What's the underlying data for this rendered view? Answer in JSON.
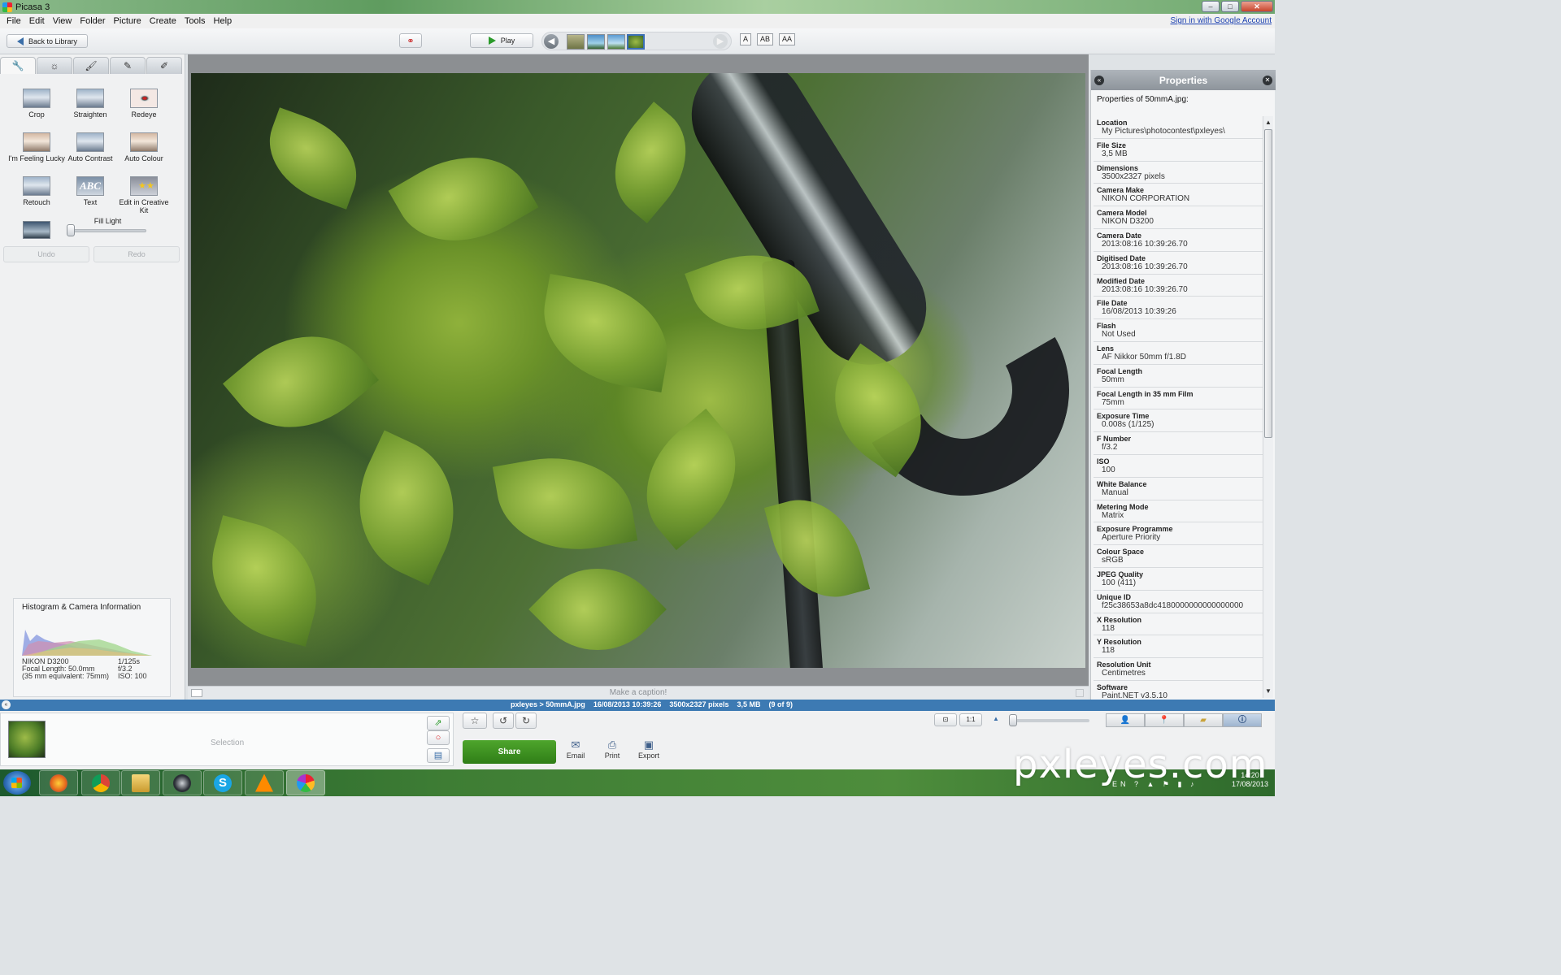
{
  "window": {
    "title": "Picasa 3",
    "controls": [
      "–",
      "□",
      "✕"
    ]
  },
  "menu": {
    "items": [
      "File",
      "Edit",
      "View",
      "Folder",
      "Picture",
      "Create",
      "Tools",
      "Help"
    ],
    "signin": "Sign in with Google Account"
  },
  "toolbar": {
    "back_label": "Back to Library",
    "play_label": "Play",
    "caption_modes": [
      "A",
      "AB",
      "AA"
    ]
  },
  "edit_panel": {
    "tabs": [
      "wrench-icon",
      "sun-icon",
      "brush-icon",
      "effects-icon",
      "effects2-icon"
    ],
    "tools": [
      "Crop",
      "Straighten",
      "Redeye",
      "I'm Feeling Lucky",
      "Auto Contrast",
      "Auto Colour",
      "Retouch",
      "Text",
      "Edit in Creative Kit"
    ],
    "fill_light_label": "Fill Light",
    "fill_light_value": 0,
    "undo_label": "Undo",
    "redo_label": "Redo"
  },
  "histogram": {
    "title": "Histogram & Camera Information",
    "camera": "NIKON D3200",
    "focal": "Focal Length: 50.0mm",
    "equiv": "(35 mm equivalent:  75mm)",
    "shutter": "1/125s",
    "aperture": "f/3.2",
    "iso": "ISO: 100"
  },
  "caption": {
    "placeholder": "Make a caption!"
  },
  "properties": {
    "title": "Properties",
    "subtitle": "Properties of 50mmA.jpg:",
    "items": [
      {
        "label": "Location",
        "value": "My Pictures\\photocontest\\pxleyes\\"
      },
      {
        "label": "File Size",
        "value": "3,5 MB"
      },
      {
        "label": "Dimensions",
        "value": "3500x2327 pixels"
      },
      {
        "label": "Camera Make",
        "value": "NIKON CORPORATION"
      },
      {
        "label": "Camera Model",
        "value": "NIKON D3200"
      },
      {
        "label": "Camera Date",
        "value": "2013:08:16 10:39:26.70"
      },
      {
        "label": "Digitised Date",
        "value": "2013:08:16 10:39:26.70"
      },
      {
        "label": "Modified Date",
        "value": "2013:08:16 10:39:26.70"
      },
      {
        "label": "File Date",
        "value": "16/08/2013 10:39:26"
      },
      {
        "label": "Flash",
        "value": "Not Used"
      },
      {
        "label": "Lens",
        "value": "AF Nikkor 50mm f/1.8D"
      },
      {
        "label": "Focal Length",
        "value": "50mm"
      },
      {
        "label": "Focal Length in 35 mm Film",
        "value": "75mm"
      },
      {
        "label": "Exposure Time",
        "value": "0.008s (1/125)"
      },
      {
        "label": "F Number",
        "value": "f/3.2"
      },
      {
        "label": "ISO",
        "value": "100"
      },
      {
        "label": "White Balance",
        "value": "Manual"
      },
      {
        "label": "Metering Mode",
        "value": "Matrix"
      },
      {
        "label": "Exposure Programme",
        "value": "Aperture Priority"
      },
      {
        "label": "Colour Space",
        "value": "sRGB"
      },
      {
        "label": "JPEG Quality",
        "value": "100 (411)"
      },
      {
        "label": "Unique ID",
        "value": "f25c38653a8dc4180000000000000000"
      },
      {
        "label": "X Resolution",
        "value": "118"
      },
      {
        "label": "Y Resolution",
        "value": "118"
      },
      {
        "label": "Resolution Unit",
        "value": "Centimetres"
      },
      {
        "label": "Software",
        "value": "Paint.NET v3.5.10"
      }
    ]
  },
  "status": {
    "path": "pxleyes > 50mmA.jpg",
    "date": "16/08/2013 10:39:26",
    "dimensions": "3500x2327 pixels",
    "size": "3,5 MB",
    "position": "(9 of 9)"
  },
  "tray": {
    "selection_label": "Selection",
    "share_label": "Share",
    "email_label": "Email",
    "print_label": "Print",
    "export_label": "Export"
  },
  "taskbar": {
    "apps": [
      "firefox-icon",
      "chrome-icon",
      "explorer-icon",
      "steam-icon",
      "skype-icon",
      "vlc-icon",
      "picasa-icon"
    ],
    "clock_time": "14:20",
    "clock_date": "17/08/2013",
    "lang": "EN"
  },
  "watermark": "pxleyes.com",
  "colors": {
    "status_bar": "#3d7ab3",
    "share_green": "#3b8e20",
    "selected_thumb": "#3b6fb6"
  }
}
